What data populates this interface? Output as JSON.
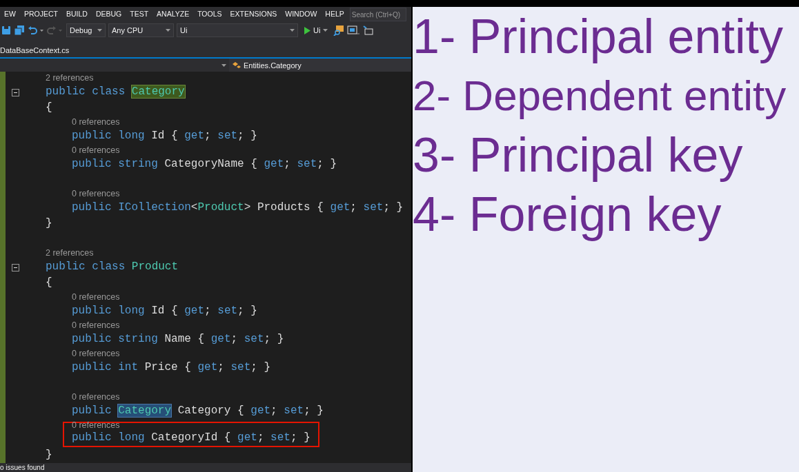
{
  "menu": [
    "EW",
    "PROJECT",
    "BUILD",
    "DEBUG",
    "TEST",
    "ANALYZE",
    "TOOLS",
    "EXTENSIONS",
    "WINDOW",
    "HELP"
  ],
  "search": {
    "placeholder": "Search (Ctrl+Q)"
  },
  "toolbar": {
    "configuration": "Debug",
    "platform": "Any CPU",
    "startup_project": "Ui",
    "run_label": "Ui",
    "redo_disabled": true
  },
  "document_tab": {
    "label": "DataBaseContext.cs"
  },
  "navigation": {
    "member": "Entities.Category"
  },
  "code": [
    {
      "lens": "2 references",
      "declaration": [
        {
          "kind": "keyword",
          "text": "public"
        },
        {
          "kind": "keyword",
          "text": "class"
        },
        {
          "kind": "match",
          "text": "Category"
        }
      ],
      "open_brace": "{",
      "close_brace": "}",
      "members": [
        {
          "lens": "0 references",
          "gap_before": false,
          "boxed": false,
          "tokens": [
            {
              "kind": "keyword",
              "text": "public long"
            },
            {
              "kind": "ident",
              "text": "Id"
            },
            {
              "kind": "punct",
              "text": "{"
            },
            {
              "kind": "keyword",
              "text": "get"
            },
            {
              "kind": "punct",
              "text": ";"
            },
            {
              "kind": "keyword",
              "text": "set"
            },
            {
              "kind": "punct",
              "text": "; }"
            }
          ]
        },
        {
          "lens": "0 references",
          "gap_before": false,
          "boxed": false,
          "tokens": [
            {
              "kind": "keyword",
              "text": "public string"
            },
            {
              "kind": "ident",
              "text": "CategoryName"
            },
            {
              "kind": "punct",
              "text": "{"
            },
            {
              "kind": "keyword",
              "text": "get"
            },
            {
              "kind": "punct",
              "text": ";"
            },
            {
              "kind": "keyword",
              "text": "set"
            },
            {
              "kind": "punct",
              "text": "; }"
            }
          ]
        },
        {
          "lens": "0 references",
          "gap_before": true,
          "boxed": false,
          "tokens": [
            {
              "kind": "keyword",
              "text": "public"
            },
            {
              "kind": "generic",
              "text": "ICollection<Product>"
            },
            {
              "kind": "ident",
              "text": "Products"
            },
            {
              "kind": "punct",
              "text": "{"
            },
            {
              "kind": "keyword",
              "text": "get"
            },
            {
              "kind": "punct",
              "text": ";"
            },
            {
              "kind": "keyword",
              "text": "set"
            },
            {
              "kind": "punct",
              "text": "; }"
            }
          ]
        }
      ]
    },
    {
      "lens": "2 references",
      "declaration": [
        {
          "kind": "keyword",
          "text": "public"
        },
        {
          "kind": "keyword",
          "text": "class"
        },
        {
          "kind": "type",
          "text": "Product"
        }
      ],
      "open_brace": "{",
      "close_brace": "}",
      "members": [
        {
          "lens": "0 references",
          "gap_before": false,
          "boxed": false,
          "tokens": [
            {
              "kind": "keyword",
              "text": "public long"
            },
            {
              "kind": "ident",
              "text": "Id"
            },
            {
              "kind": "punct",
              "text": "{"
            },
            {
              "kind": "keyword",
              "text": "get"
            },
            {
              "kind": "punct",
              "text": ";"
            },
            {
              "kind": "keyword",
              "text": "set"
            },
            {
              "kind": "punct",
              "text": "; }"
            }
          ]
        },
        {
          "lens": "0 references",
          "gap_before": false,
          "boxed": false,
          "tokens": [
            {
              "kind": "keyword",
              "text": "public string"
            },
            {
              "kind": "ident",
              "text": "Name"
            },
            {
              "kind": "punct",
              "text": "{"
            },
            {
              "kind": "keyword",
              "text": "get"
            },
            {
              "kind": "punct",
              "text": ";"
            },
            {
              "kind": "keyword",
              "text": "set"
            },
            {
              "kind": "punct",
              "text": "; }"
            }
          ]
        },
        {
          "lens": "0 references",
          "gap_before": false,
          "boxed": false,
          "tokens": [
            {
              "kind": "keyword",
              "text": "public int"
            },
            {
              "kind": "ident",
              "text": "Price"
            },
            {
              "kind": "punct",
              "text": "{"
            },
            {
              "kind": "keyword",
              "text": "get"
            },
            {
              "kind": "punct",
              "text": ";"
            },
            {
              "kind": "keyword",
              "text": "set"
            },
            {
              "kind": "punct",
              "text": "; }"
            }
          ]
        },
        {
          "lens": "0 references",
          "gap_before": true,
          "boxed": false,
          "tokens": [
            {
              "kind": "keyword",
              "text": "public"
            },
            {
              "kind": "selection",
              "text": "Category"
            },
            {
              "kind": "ident",
              "text": "Category"
            },
            {
              "kind": "punct",
              "text": "{"
            },
            {
              "kind": "keyword",
              "text": "get"
            },
            {
              "kind": "punct",
              "text": ";"
            },
            {
              "kind": "keyword",
              "text": "set"
            },
            {
              "kind": "punct",
              "text": "; }"
            }
          ]
        },
        {
          "lens": "0 references",
          "gap_before": false,
          "boxed": true,
          "tokens": [
            {
              "kind": "keyword",
              "text": "public long"
            },
            {
              "kind": "ident",
              "text": "CategoryId"
            },
            {
              "kind": "punct",
              "text": "{"
            },
            {
              "kind": "keyword",
              "text": "get"
            },
            {
              "kind": "punct",
              "text": ";"
            },
            {
              "kind": "keyword",
              "text": "set"
            },
            {
              "kind": "punct",
              "text": "; }"
            }
          ]
        }
      ]
    }
  ],
  "status_bar": {
    "issues": "o issues found"
  },
  "slide": {
    "items": [
      "1- Principal entity",
      "2- Dependent entity",
      "3- Principal key",
      "4- Foreign key"
    ]
  }
}
